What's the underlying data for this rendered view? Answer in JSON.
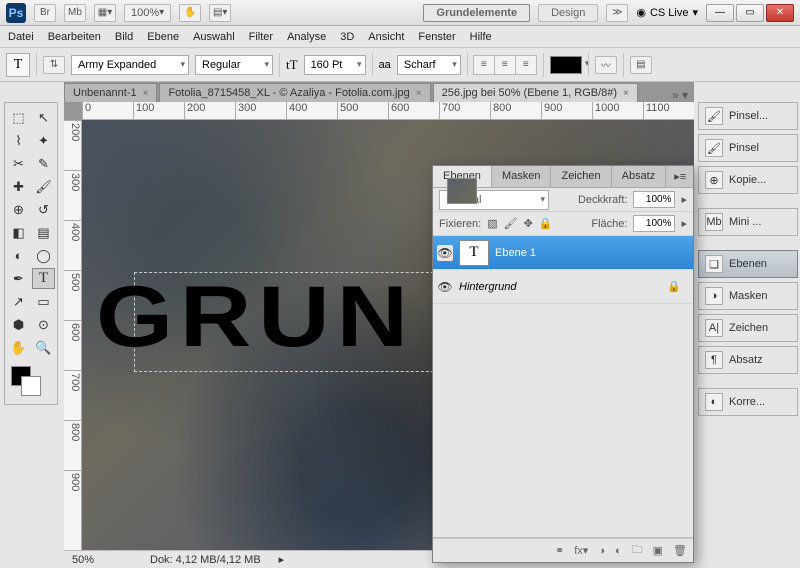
{
  "titlebar": {
    "br": "Br",
    "mb": "Mb",
    "zoom": "100%",
    "grund": "Grundelemente",
    "design": "Design",
    "cslive": "CS Live"
  },
  "menu": [
    "Datei",
    "Bearbeiten",
    "Bild",
    "Ebene",
    "Auswahl",
    "Filter",
    "Analyse",
    "3D",
    "Ansicht",
    "Fenster",
    "Hilfe"
  ],
  "options": {
    "font": "Army Expanded",
    "weight": "Regular",
    "size": "160 Pt",
    "aa_label": "aa",
    "aa": "Scharf"
  },
  "tabs": {
    "t1": "Unbenannt-1",
    "t2": "Fotolia_8715458_XL - © Azaliya - Fotolia.com.jpg",
    "t3": "256.jpg bei 50% (Ebene 1, RGB/8#)"
  },
  "ruler_h": [
    "0",
    "100",
    "200",
    "300",
    "400",
    "500",
    "600",
    "700",
    "800",
    "900",
    "1000",
    "1100"
  ],
  "ruler_v": [
    "200",
    "300",
    "400",
    "500",
    "600",
    "700",
    "800",
    "900"
  ],
  "canvas": {
    "text": "GRUN"
  },
  "rdock": {
    "pinsel1": "Pinsel...",
    "pinsel2": "Pinsel",
    "kopie": "Kopie...",
    "mini": "Mini ...",
    "ebenen": "Ebenen",
    "masken": "Masken",
    "zeichen": "Zeichen",
    "absatz": "Absatz",
    "korre": "Korre..."
  },
  "panel": {
    "tabs": {
      "ebenen": "Ebenen",
      "masken": "Masken",
      "zeichen": "Zeichen",
      "absatz": "Absatz"
    },
    "blend": "Normal",
    "deck_l": "Deckkraft:",
    "deck_v": "100%",
    "fix_l": "Fixieren:",
    "flache_l": "Fläche:",
    "flache_v": "100%",
    "layers": [
      {
        "name": "Ebene 1",
        "type": "T",
        "sel": true
      },
      {
        "name": "Hintergrund",
        "type": "bg",
        "locked": true,
        "italic": true
      }
    ]
  },
  "status": {
    "zoom": "50%",
    "doc": "Dok: 4,12 MB/4,12 MB"
  }
}
